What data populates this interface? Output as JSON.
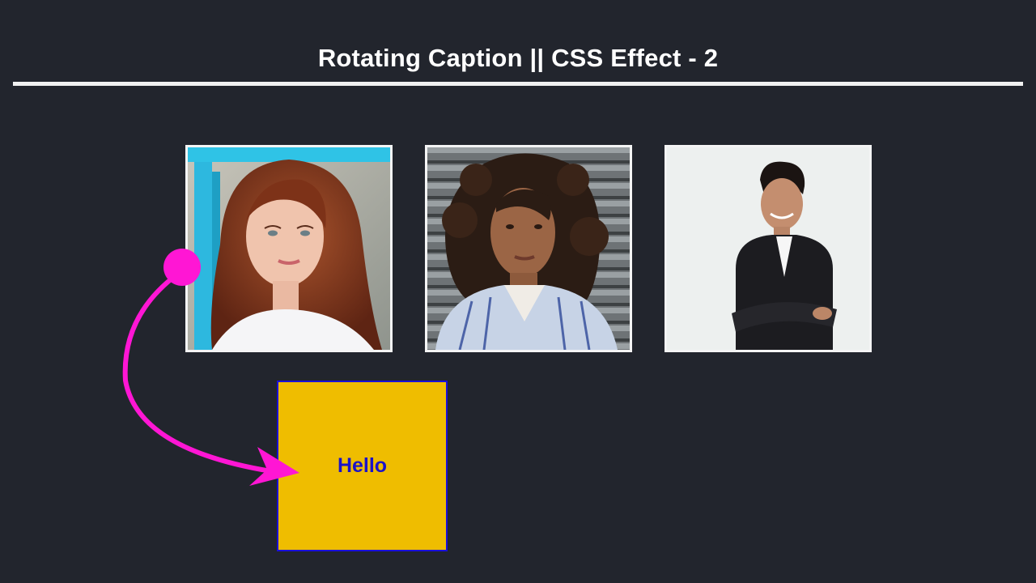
{
  "page": {
    "title": "Rotating Caption || CSS Effect - 2",
    "background": "#22252d",
    "divider_color": "#f1f1f1"
  },
  "gallery": {
    "cards": [
      {
        "name": "woman-red-hair-photo"
      },
      {
        "name": "woman-curly-hair-photo"
      },
      {
        "name": "man-suit-photo"
      }
    ],
    "border_color": "#f4f4f4"
  },
  "caption": {
    "text": "Hello",
    "background": "#efbd00",
    "text_color": "#1b12c8"
  },
  "annotation": {
    "arrow_color": "#ff16d4",
    "icon": "curved-arrow-icon"
  }
}
